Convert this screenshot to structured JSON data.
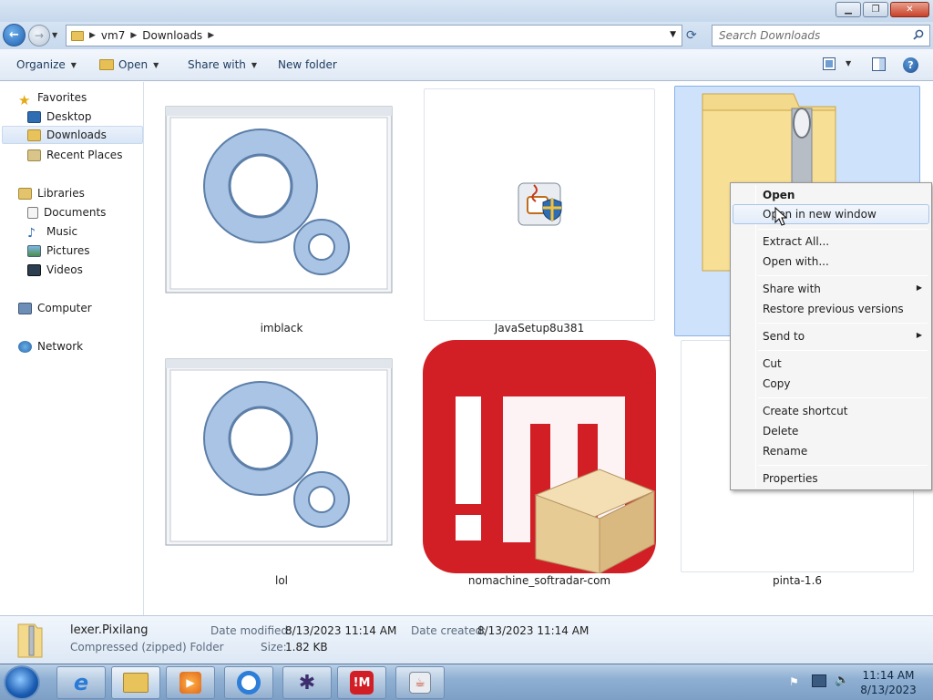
{
  "window": {
    "min_label": "▁",
    "max_label": "❐",
    "close_label": "✕"
  },
  "address": {
    "crumbs": [
      "vm7",
      "Downloads"
    ],
    "search_placeholder": "Search Downloads"
  },
  "toolbar": {
    "organize": "Organize",
    "open": "Open",
    "share_with": "Share with",
    "new_folder": "New folder"
  },
  "nav": {
    "favorites": "Favorites",
    "desktop": "Desktop",
    "downloads": "Downloads",
    "recent_places": "Recent Places",
    "libraries": "Libraries",
    "documents": "Documents",
    "music": "Music",
    "pictures": "Pictures",
    "videos": "Videos",
    "computer": "Computer",
    "network": "Network"
  },
  "files": [
    {
      "name": "imblack",
      "icon": "gears-app-icon"
    },
    {
      "name": "JavaSetup8u381",
      "icon": "java-installer-icon"
    },
    {
      "name": "lexer.Pixilang",
      "icon": "zip-folder-icon",
      "label_visible": false
    },
    {
      "name": "lol",
      "icon": "gears-app-icon"
    },
    {
      "name": "nomachine_softradar-com",
      "icon": "nomachine-box-icon"
    },
    {
      "name": "pinta-1.6",
      "icon": "blank-file-icon"
    }
  ],
  "details": {
    "name": "lexer.Pixilang",
    "type": "Compressed (zipped) Folder",
    "modified_label": "Date modified:",
    "modified_value": "8/13/2023 11:14 AM",
    "created_label": "Date created:",
    "created_value": "8/13/2023 11:14 AM",
    "size_label": "Size:",
    "size_value": "1.82 KB"
  },
  "context_menu": {
    "items": [
      "Open",
      "Open in new window",
      "Extract All...",
      "Open with...",
      "Share with",
      "Restore previous versions",
      "Send to",
      "Cut",
      "Copy",
      "Create shortcut",
      "Delete",
      "Rename",
      "Properties"
    ]
  },
  "taskbar": {
    "time": "11:14 AM",
    "date": "8/13/2023"
  },
  "colors": {
    "accent": "#3a6ea5",
    "selection": "#cfe2fb",
    "nomachine_red": "#d21f26"
  }
}
